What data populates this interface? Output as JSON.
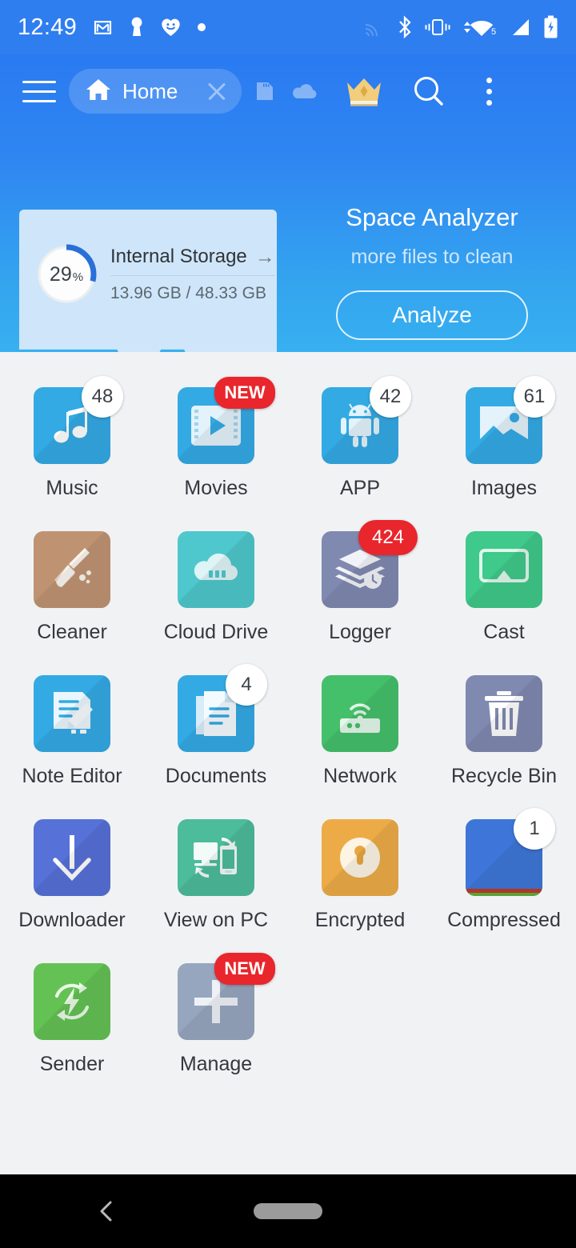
{
  "status_bar": {
    "time": "12:49",
    "left_icons": [
      "gmail-icon",
      "keyhole-icon",
      "heart-face-icon",
      "dot-icon"
    ],
    "right_icons": [
      "cast-icon-dim",
      "bluetooth-icon",
      "vibrate-icon",
      "wifi-icon",
      "signal-icon",
      "battery-charging-icon"
    ],
    "wifi_label": "5"
  },
  "toolbar": {
    "menu_icon": "hamburger-icon",
    "tab_label": "Home",
    "tab_home_icon": "home-icon",
    "tab_close_icon": "close-icon",
    "sdcard_icon": "sdcard-icon",
    "cloud_icon": "cloud-icon",
    "premium_icon": "crown-icon",
    "search_icon": "search-icon",
    "more_icon": "overflow-menu-icon"
  },
  "storage_card": {
    "percent": "29",
    "percent_symbol": "%",
    "title": "Internal Storage",
    "arrow": "→",
    "usage": "13.96 GB / 48.33 GB",
    "ring_fill_color": "#2a6fd8",
    "ring_track_color": "#ffffff",
    "card_color": "#cfe6fa"
  },
  "promo": {
    "title": "Space Analyzer",
    "subtitle": "more files to clean",
    "button_label": "Analyze"
  },
  "colors": {
    "header_top": "#2a7af1",
    "header_bottom": "#37b0f0",
    "page_bg": "#f1f2f4",
    "badge_red": "#e8262c",
    "nav_bg": "#000000"
  },
  "apps": [
    {
      "name": "Music",
      "icon": "music-note-icon",
      "tile": "#33aae4",
      "badge": "48",
      "badge_style": "white"
    },
    {
      "name": "Movies",
      "icon": "video-play-icon",
      "tile": "#33aae4",
      "badge": "NEW",
      "badge_style": "red-text"
    },
    {
      "name": "APP",
      "icon": "android-icon",
      "tile": "#33aae4",
      "badge": "42",
      "badge_style": "white"
    },
    {
      "name": "Images",
      "icon": "photo-icon",
      "tile": "#33aae4",
      "badge": "61",
      "badge_style": "white"
    },
    {
      "name": "Cleaner",
      "icon": "broom-icon",
      "tile": "#bf9372",
      "badge": "",
      "badge_style": "none"
    },
    {
      "name": "Cloud Drive",
      "icon": "cloud-drive-icon",
      "tile": "#4ec8cc",
      "badge": "",
      "badge_style": "none"
    },
    {
      "name": "Logger",
      "icon": "layers-clock-icon",
      "tile": "#8089b0",
      "badge": "424",
      "badge_style": "red-num"
    },
    {
      "name": "Cast",
      "icon": "cast-screen-icon",
      "tile": "#3fc98a",
      "badge": "",
      "badge_style": "none"
    },
    {
      "name": "Note Editor",
      "icon": "note-pencil-icon",
      "tile": "#33aae4",
      "badge": "",
      "badge_style": "none"
    },
    {
      "name": "Documents",
      "icon": "document-icon",
      "tile": "#33aae4",
      "badge": "4",
      "badge_style": "white"
    },
    {
      "name": "Network",
      "icon": "router-wifi-icon",
      "tile": "#45c06a",
      "badge": "",
      "badge_style": "none"
    },
    {
      "name": "Recycle Bin",
      "icon": "trash-icon",
      "tile": "#8089b0",
      "badge": "",
      "badge_style": "none"
    },
    {
      "name": "Downloader",
      "icon": "download-arrow-icon",
      "tile": "#5671d8",
      "badge": "",
      "badge_style": "none"
    },
    {
      "name": "View on PC",
      "icon": "pc-phone-sync-icon",
      "tile": "#4cbc9b",
      "badge": "",
      "badge_style": "none"
    },
    {
      "name": "Encrypted",
      "icon": "lock-circle-icon",
      "tile": "#edab47",
      "badge": "",
      "badge_style": "none"
    },
    {
      "name": "Compressed",
      "icon": "zip-icon",
      "tile": "#3d76d8",
      "badge": "1",
      "badge_style": "white"
    },
    {
      "name": "Sender",
      "icon": "sender-sync-icon",
      "tile": "#64c255",
      "badge": "",
      "badge_style": "none"
    },
    {
      "name": "Manage",
      "icon": "plus-icon",
      "tile": "#97a6bf",
      "badge": "NEW",
      "badge_style": "red-text"
    }
  ],
  "navbar": {
    "back_icon": "back-chevron-icon",
    "home_pill": "home-pill-icon"
  }
}
